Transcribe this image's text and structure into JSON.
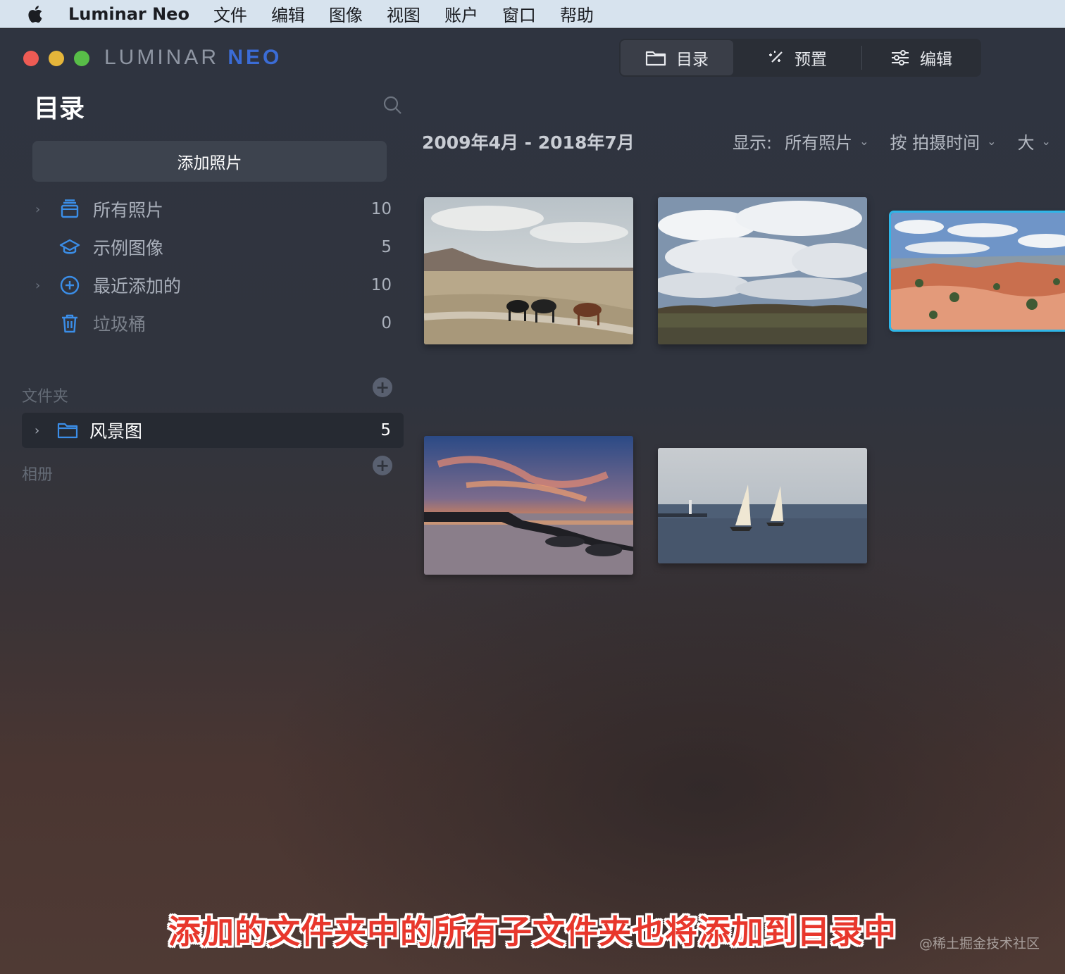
{
  "menubar": {
    "app_name": "Luminar Neo",
    "items": [
      "文件",
      "编辑",
      "图像",
      "视图",
      "账户",
      "窗口",
      "帮助"
    ]
  },
  "window": {
    "brand_part1": "LUMINAR ",
    "brand_part2": "NEO",
    "tabs": [
      {
        "label": "目录",
        "icon": "folder-icon",
        "active": true
      },
      {
        "label": "预置",
        "icon": "magic-wand-icon",
        "active": false
      },
      {
        "label": "编辑",
        "icon": "sliders-icon",
        "active": false
      }
    ]
  },
  "sidebar": {
    "title": "目录",
    "add_button": "添加照片",
    "items": [
      {
        "label": "所有照片",
        "count": "10",
        "icon": "photos-stack-icon",
        "has_chevron": true
      },
      {
        "label": "示例图像",
        "count": "5",
        "icon": "graduation-cap-icon",
        "has_chevron": false
      },
      {
        "label": "最近添加的",
        "count": "10",
        "icon": "plus-circle-icon",
        "has_chevron": true
      },
      {
        "label": "垃圾桶",
        "count": "0",
        "icon": "trash-icon",
        "has_chevron": false
      }
    ],
    "folders_label": "文件夹",
    "folders": [
      {
        "label": "风景图",
        "count": "5",
        "icon": "folder-icon"
      }
    ],
    "albums_label": "相册"
  },
  "main": {
    "date_range": "2009年4月 - 2018年7月",
    "show_label": "显示:",
    "show_value": "所有照片",
    "sort_value": "按 拍摄时间",
    "size_value": "大",
    "photos": [
      {
        "subject": "cattle-on-prairie-road"
      },
      {
        "subject": "cloudy-sky-grassland"
      },
      {
        "subject": "red-canyon-hoodoos",
        "selected": true
      },
      {
        "subject": "sunset-over-lake-rocks"
      },
      {
        "subject": "sailboats-on-sea"
      }
    ]
  },
  "overlay": {
    "subtitle": "添加的文件夹中的所有子文件夹也将添加到目录中",
    "watermark": "@稀土掘金技术社区"
  },
  "colors": {
    "accent_blue": "#3b8ee8",
    "selection_cyan": "#2fb6e8",
    "subtitle_red": "#e8372c"
  }
}
